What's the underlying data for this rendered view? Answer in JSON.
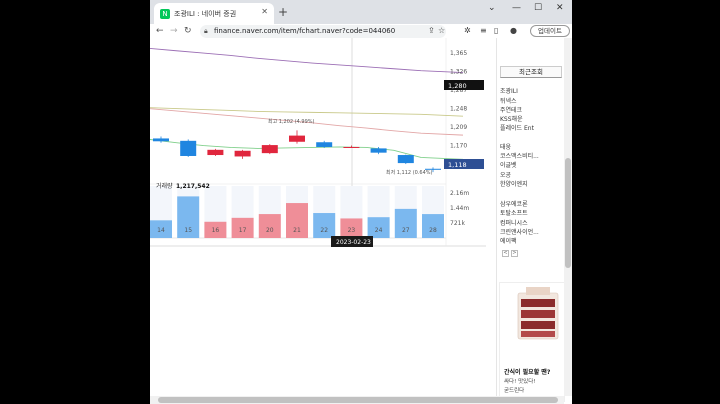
{
  "browser": {
    "tab_title": "조광ILI : 네이버 증권",
    "favicon_letter": "N",
    "url": "finance.naver.com/item/fchart.naver?code=044060",
    "update_label": "업데이트"
  },
  "chart_data": {
    "type": "candlestick",
    "x": [
      "14",
      "15",
      "16",
      "17",
      "20",
      "21",
      "22",
      "23",
      "24",
      "27",
      "28"
    ],
    "price_ticks": [
      "1,365",
      "1,326",
      "1,287",
      "1,248",
      "1,209",
      "1,170",
      "1,131"
    ],
    "ylim": [
      1110,
      1380
    ],
    "candles": [
      {
        "x": "14",
        "open": 1185,
        "close": 1179,
        "high": 1189,
        "low": 1176
      },
      {
        "x": "15",
        "open": 1180,
        "close": 1148,
        "high": 1183,
        "low": 1146
      },
      {
        "x": "16",
        "open": 1150,
        "close": 1161,
        "high": 1163,
        "low": 1148
      },
      {
        "x": "17",
        "open": 1147,
        "close": 1159,
        "high": 1161,
        "low": 1142
      },
      {
        "x": "20",
        "open": 1154,
        "close": 1171,
        "high": 1173,
        "low": 1152
      },
      {
        "x": "21",
        "open": 1178,
        "close": 1191,
        "high": 1202,
        "low": 1174
      },
      {
        "x": "22",
        "open": 1177,
        "close": 1167,
        "high": 1180,
        "low": 1165
      },
      {
        "x": "23",
        "open": 1167,
        "close": 1167,
        "high": 1170,
        "low": 1165
      },
      {
        "x": "24",
        "open": 1164,
        "close": 1155,
        "high": 1167,
        "low": 1152
      },
      {
        "x": "27",
        "open": 1150,
        "close": 1133,
        "high": 1151,
        "low": 1131
      },
      {
        "x": "28",
        "open": 1121,
        "close": 1119,
        "high": 1124,
        "low": 1114
      }
    ],
    "moving_averages": [
      {
        "color": "#9c6fb5",
        "values": [
          1375,
          1370,
          1365,
          1360,
          1354,
          1349,
          1344,
          1340,
          1336,
          1332,
          1328
        ]
      },
      {
        "color": "#e2a6a6",
        "values": [
          1248,
          1243,
          1238,
          1233,
          1228,
          1223,
          1218,
          1212,
          1207,
          1201,
          1196
        ]
      },
      {
        "color": "#c9c98a",
        "values": [
          1250,
          1248,
          1246,
          1244,
          1242,
          1241,
          1240,
          1239,
          1238,
          1237,
          1236
        ]
      },
      {
        "color": "#7fcf8a",
        "values": [
          1183,
          1176,
          1170,
          1166,
          1164,
          1165,
          1166,
          1167,
          1166,
          1160,
          1145
        ]
      }
    ],
    "current_price": "1,280",
    "last_price": "1,118",
    "high_annotation": "최고 1,202 (4.99%)",
    "low_annotation": "최저 1,112 (0.64%)",
    "volume_label": "거래량",
    "volume_value": "1,217,542",
    "volume_ticks": [
      "2.16m",
      "1.44m",
      "721k"
    ],
    "volume_ylim": [
      0,
      2500000
    ],
    "volumes": [
      {
        "x": "14",
        "value": 850000,
        "up": false
      },
      {
        "x": "15",
        "value": 2000000,
        "up": false
      },
      {
        "x": "16",
        "value": 780000,
        "up": true
      },
      {
        "x": "17",
        "value": 970000,
        "up": true
      },
      {
        "x": "20",
        "value": 1150000,
        "up": true
      },
      {
        "x": "21",
        "value": 1680000,
        "up": true
      },
      {
        "x": "22",
        "value": 1200000,
        "up": false
      },
      {
        "x": "23",
        "value": 940000,
        "up": true
      },
      {
        "x": "24",
        "value": 1000000,
        "up": false
      },
      {
        "x": "27",
        "value": 1400000,
        "up": false
      },
      {
        "x": "28",
        "value": 1150000,
        "up": false
      }
    ],
    "crosshair_date": "2023-02-23",
    "colors": {
      "up": "#e0263d",
      "down": "#1f85e0",
      "up_vol": "#ef8e98",
      "down_vol": "#7bb8ef"
    }
  },
  "sidebar": {
    "header": "최근조회",
    "items": [
      "조광ILI",
      "뒤넥스",
      "주연테크",
      "KSS해운",
      "플레이드 Ent",
      "태웅",
      "코스맥스비티...",
      "이글벳",
      "오공",
      "한양이엔지",
      "삼우에코론",
      "토탈소프트",
      "컴퍼니시스",
      "크린앤사이언...",
      "에이팩"
    ],
    "prev_page": "<",
    "next_page": ">",
    "ad_title": "간식이 필요할 땐?",
    "ad_line1": "싸다! 맛있다!",
    "ad_line2": "굳드린다"
  }
}
